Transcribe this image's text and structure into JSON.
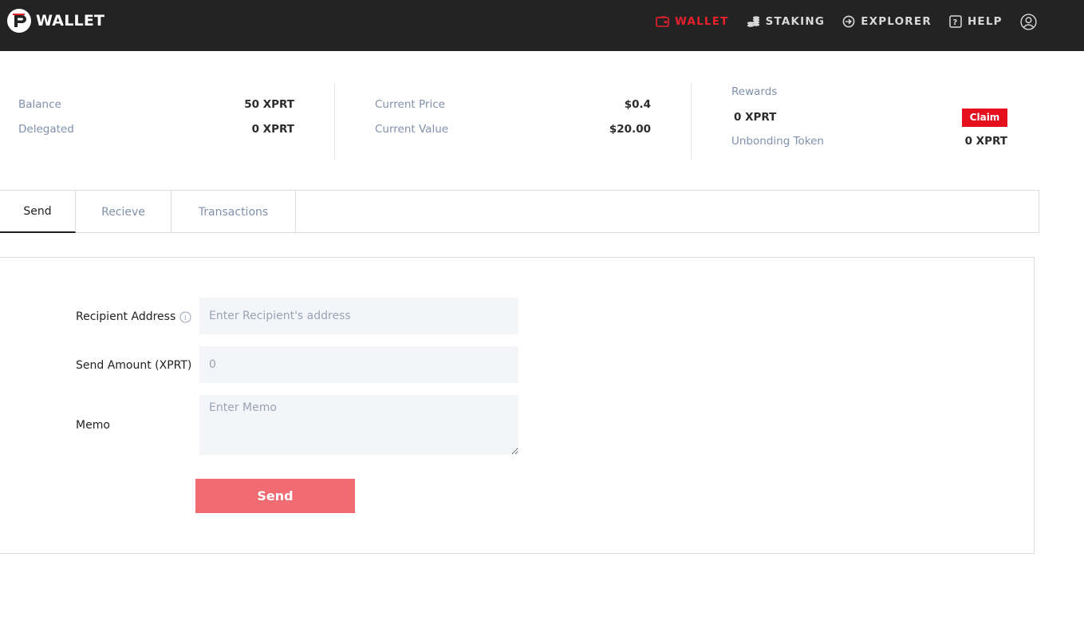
{
  "header": {
    "brand": "WALLET",
    "nav": [
      {
        "label": "WALLET",
        "icon": "wallet-icon",
        "active": true
      },
      {
        "label": "STAKING",
        "icon": "coins-icon",
        "active": false
      },
      {
        "label": "EXPLORER",
        "icon": "explorer-icon",
        "active": false
      },
      {
        "label": "HELP",
        "icon": "help-icon",
        "active": false
      }
    ],
    "user_icon": "user-icon"
  },
  "stats": {
    "balance_label": "Balance",
    "balance_value": "50 XPRT",
    "delegated_label": "Delegated",
    "delegated_value": "0 XPRT",
    "price_label": "Current Price",
    "price_value": "$0.4",
    "value_label": "Current Value",
    "value_value": "$20.00",
    "rewards_label": "Rewards",
    "rewards_value": "0 XPRT",
    "claim_label": "Claim",
    "unbonding_label": "Unbonding Token",
    "unbonding_value": "0 XPRT"
  },
  "tabs": [
    {
      "label": "Send",
      "active": true
    },
    {
      "label": "Recieve",
      "active": false
    },
    {
      "label": "Transactions",
      "active": false
    }
  ],
  "form": {
    "recipient_label": "Recipient Address",
    "recipient_placeholder": "Enter Recipient's address",
    "amount_label": "Send Amount (XPRT)",
    "amount_placeholder": "0",
    "memo_label": "Memo",
    "memo_placeholder": "Enter Memo",
    "send_label": "Send"
  },
  "colors": {
    "header_bg": "#232323",
    "accent_red": "#e5212e",
    "claim_red": "#e5101d",
    "send_button": "#f06b72",
    "label_muted": "#8190ab",
    "input_bg": "#f3f5f9"
  }
}
